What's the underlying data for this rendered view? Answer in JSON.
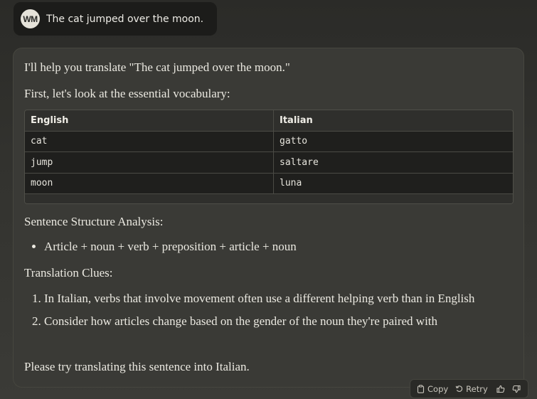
{
  "user_message": {
    "avatar_initials": "WM",
    "text": "The cat jumped over the moon."
  },
  "assistant": {
    "intro": "I'll help you translate \"The cat jumped over the moon.\"",
    "vocab_intro": "First, let's look at the essential vocabulary:",
    "table": {
      "headers": [
        "English",
        "Italian"
      ],
      "rows": [
        [
          "cat",
          "gatto"
        ],
        [
          "jump",
          "saltare"
        ],
        [
          "moon",
          "luna"
        ]
      ]
    },
    "structure_heading": "Sentence Structure Analysis:",
    "structure_items": [
      "Article + noun + verb + preposition + article + noun"
    ],
    "clues_heading": "Translation Clues:",
    "clues": [
      "In Italian, verbs that involve movement often use a different helping verb than in English",
      "Consider how articles change based on the gender of the noun they're paired with"
    ],
    "closing": "Please try translating this sentence into Italian."
  },
  "actions": {
    "copy_label": "Copy",
    "retry_label": "Retry",
    "copy_icon": "clipboard-icon",
    "retry_icon": "retry-arrow-icon",
    "thumbs_up_icon": "thumbs-up-icon",
    "thumbs_down_icon": "thumbs-down-icon"
  }
}
